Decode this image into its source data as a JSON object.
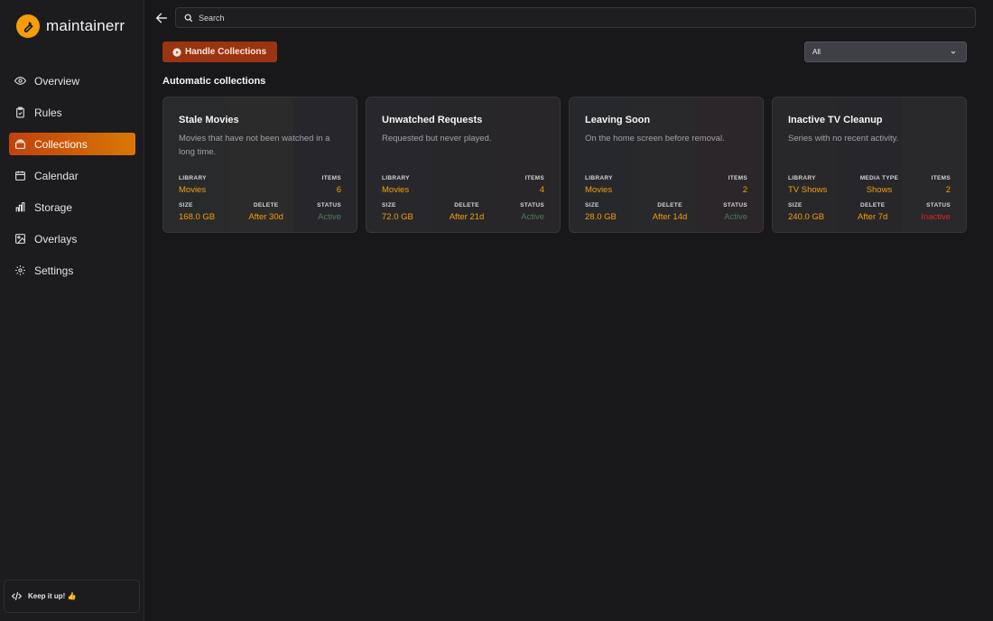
{
  "app": {
    "name": "maintainerr"
  },
  "nav": [
    {
      "id": "overview",
      "label": "Overview",
      "icon": "eye-icon"
    },
    {
      "id": "rules",
      "label": "Rules",
      "icon": "clipboard-check-icon"
    },
    {
      "id": "collections",
      "label": "Collections",
      "icon": "archive-icon",
      "active": true
    },
    {
      "id": "calendar",
      "label": "Calendar",
      "icon": "calendar-icon"
    },
    {
      "id": "storage",
      "label": "Storage",
      "icon": "bar-chart-icon"
    },
    {
      "id": "overlays",
      "label": "Overlays",
      "icon": "image-icon"
    },
    {
      "id": "settings",
      "label": "Settings",
      "icon": "gear-icon"
    }
  ],
  "footer": {
    "label": "Keep it up! 👍"
  },
  "search": {
    "placeholder": "Search"
  },
  "toolbar": {
    "handle_label": "Handle Collections",
    "filter_value": "All"
  },
  "section": {
    "title": "Automatic collections"
  },
  "labels": {
    "library": "LIBRARY",
    "items": "ITEMS",
    "size": "SIZE",
    "delete": "DELETE",
    "status": "STATUS",
    "media_type": "MEDIA TYPE"
  },
  "colors": {
    "accent": "#d97706",
    "button": "#9a3412",
    "active_status": "#4b7a5e",
    "inactive_status": "#dc2626",
    "value": "#f59e0b"
  },
  "cards": [
    {
      "title": "Stale Movies",
      "description": "Movies that have not been watched in a long time.",
      "library": "Movies",
      "items": "6",
      "size": "168.0 GB",
      "delete": "After 30d",
      "status": "Active"
    },
    {
      "title": "Unwatched Requests",
      "description": "Requested but never played.",
      "library": "Movies",
      "items": "4",
      "size": "72.0 GB",
      "delete": "After 21d",
      "status": "Active"
    },
    {
      "title": "Leaving Soon",
      "description": "On the home screen before removal.",
      "library": "Movies",
      "items": "2",
      "size": "28.0 GB",
      "delete": "After 14d",
      "status": "Active"
    },
    {
      "title": "Inactive TV Cleanup",
      "description": "Series with no recent activity.",
      "library": "TV Shows",
      "media_type": "Shows",
      "items": "2",
      "size": "240.0 GB",
      "delete": "After 7d",
      "status": "Inactive"
    }
  ]
}
